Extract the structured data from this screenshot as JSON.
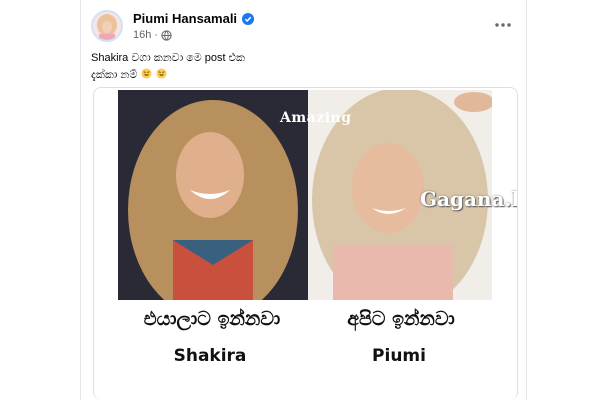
{
  "post": {
    "author": "Piumi Hansamali",
    "time": "16h",
    "caption_line1": "Shakira වගා කනවා මෙ post එක",
    "caption_line2": "දැක්කා නම්",
    "icons": {
      "avatar": "profile-photo",
      "verified": "verified-badge-icon",
      "audience": "globe-icon",
      "more": "more-options-icon",
      "emoji": "rolling-on-floor-laughing-emoji"
    },
    "colors": {
      "verified": "#1877f2",
      "meta": "#65676b",
      "text": "#050505"
    }
  },
  "meme": {
    "overlay_text": "Amazing",
    "watermark": "Gagana.lk",
    "left_caption": "එයාලාට ඉන්නවා",
    "right_caption": "අපිට ඉන්නවා",
    "left_name": "Shakira",
    "right_name": "Piumi"
  }
}
